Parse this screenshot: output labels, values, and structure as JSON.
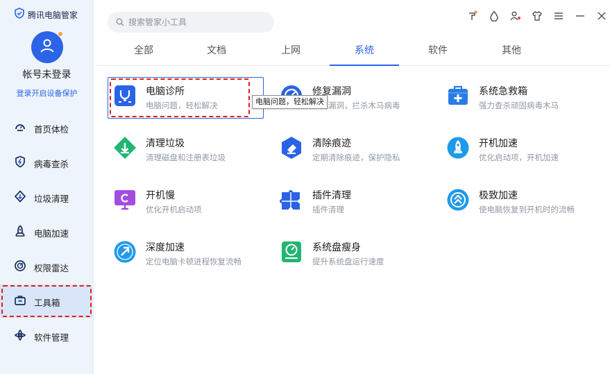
{
  "app": {
    "title": "腾讯电脑管家"
  },
  "user": {
    "name": "帐号未登录",
    "login_link": "登录开启设备保护"
  },
  "search": {
    "placeholder": "搜索管家小工具"
  },
  "sidebar": {
    "items": [
      {
        "label": "首页体检",
        "icon": "home-check-icon"
      },
      {
        "label": "病毒查杀",
        "icon": "virus-shield-icon"
      },
      {
        "label": "垃圾清理",
        "icon": "broom-icon"
      },
      {
        "label": "电脑加速",
        "icon": "rocket-icon"
      },
      {
        "label": "权限雷达",
        "icon": "radar-icon"
      },
      {
        "label": "工具箱",
        "icon": "toolbox-icon",
        "active": true
      },
      {
        "label": "软件管理",
        "icon": "software-icon"
      }
    ]
  },
  "tabs": [
    {
      "label": "全部"
    },
    {
      "label": "文档"
    },
    {
      "label": "上网"
    },
    {
      "label": "系统",
      "active": true
    },
    {
      "label": "软件"
    },
    {
      "label": "其他"
    }
  ],
  "tools": [
    {
      "name": "电脑诊所",
      "desc": "电脑问题，轻松解决",
      "icon": "stethoscope-icon",
      "color": "#2a63e6"
    },
    {
      "name": "修复漏洞",
      "desc": "修复漏洞，拦杀木马病毒",
      "icon": "bug-fix-icon",
      "color": "#2a63e6"
    },
    {
      "name": "系统急救箱",
      "desc": "强力查杀顽固病毒木马",
      "icon": "first-aid-kit-icon",
      "color": "#2a7be6"
    },
    {
      "name": "清理垃圾",
      "desc": "清理磁盘和注册表垃圾",
      "icon": "broom-icon",
      "color": "#22b573"
    },
    {
      "name": "清除痕迹",
      "desc": "定期清除痕迹，保护隐私",
      "icon": "eraser-icon",
      "color": "#2a63e6"
    },
    {
      "name": "开机加速",
      "desc": "优化启动项，开机加速",
      "icon": "rocket-icon",
      "color": "#1f9ae8"
    },
    {
      "name": "开机慢",
      "desc": "优化开机启动项",
      "icon": "monitor-icon",
      "color": "#a44be0"
    },
    {
      "name": "插件清理",
      "desc": "插件清理",
      "icon": "puzzle-icon",
      "color": "#2a63e6"
    },
    {
      "name": "极致加速",
      "desc": "使电脑恢复到开机时的流畅",
      "icon": "speed-icon",
      "color": "#1f9ae8"
    },
    {
      "name": "深度加速",
      "desc": "定位电脑卡顿进程恢复流畅",
      "icon": "deep-speed-icon",
      "color": "#1f9ae8"
    },
    {
      "name": "系统盘瘦身",
      "desc": "提升系统盘运行速度",
      "icon": "disk-slim-icon",
      "color": "#22b573"
    }
  ],
  "tooltip": {
    "text": "电脑问题，轻松解决"
  },
  "window_controls": [
    "skin-icon",
    "water-drop-icon",
    "user-settings-icon",
    "shirt-icon",
    "menu-icon",
    "minimize-icon",
    "close-icon"
  ],
  "colors": {
    "accent": "#2a63e6",
    "highlight": "#e01a1a"
  }
}
